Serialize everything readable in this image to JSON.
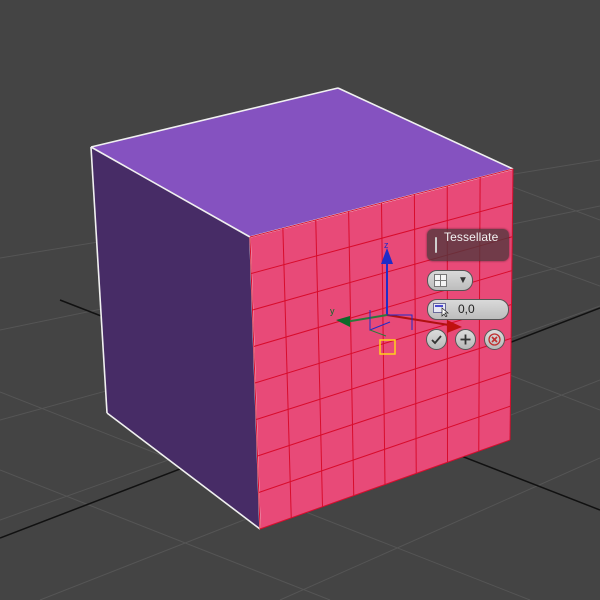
{
  "caddy": {
    "title": "Tessellate",
    "tension_value": "0,0",
    "mode_icon": "grid-tessellate-icon",
    "spinner_icon": "spinner-icon",
    "ok_icon": "checkmark-icon",
    "apply_icon": "plus-icon",
    "cancel_icon": "close-icon"
  },
  "viewport": {
    "background": "#444444",
    "grid_color": "#555555",
    "grid_axis_color": "#111111",
    "cube_top_color": "#8552c0",
    "cube_left_color": "#472c66",
    "cube_front_color": "#e84a78",
    "edge_color": "#d80c2c",
    "gizmo_axes": {
      "x": "x",
      "y": "y",
      "z": "z"
    }
  }
}
